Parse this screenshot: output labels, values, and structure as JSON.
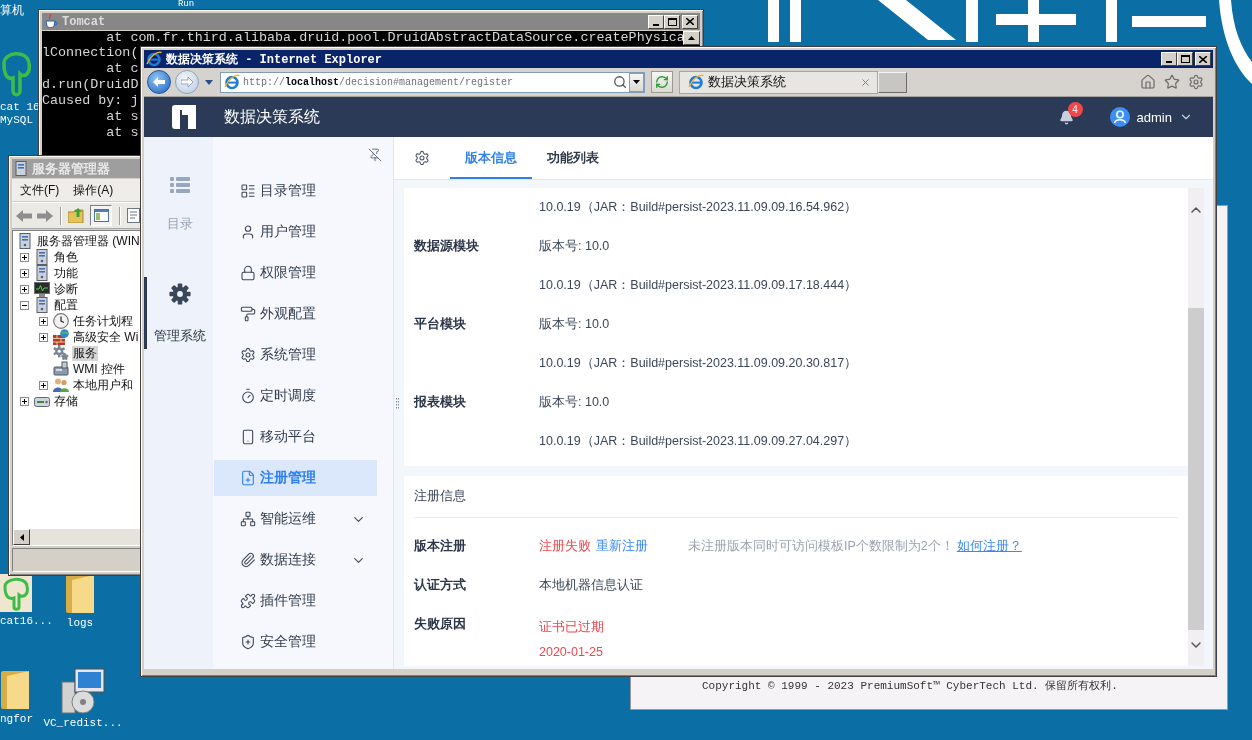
{
  "desktop": {
    "icons": [
      {
        "kind": "label",
        "label": [
          "算机"
        ]
      },
      {
        "kind": "label",
        "label": [
          "Run"
        ]
      },
      {
        "kind": "elephant",
        "label": [
          "cat 16",
          "MySQL"
        ]
      },
      {
        "kind": "elephant_tile",
        "label": [
          "cat16..."
        ]
      },
      {
        "kind": "folder",
        "label": [
          "logs"
        ]
      },
      {
        "kind": "folder",
        "label": [
          "ngfor"
        ]
      },
      {
        "kind": "installer",
        "label": [
          "VC_redist..."
        ]
      }
    ]
  },
  "tomcat_window": {
    "title": "Tomcat",
    "console_lines": [
      "        at com.fr.third.alibaba.druid.pool.DruidAbstractDataSource.createPhysica",
      "lConnection(",
      "        at c",
      "d.run(DruidD",
      "Caused by: j",
      "        at s",
      "        at s"
    ]
  },
  "server_manager_window": {
    "title": "服务器管理器",
    "menu": [
      "文件(F)",
      "操作(A)"
    ],
    "tree": [
      {
        "label": "服务器管理器 (WIN",
        "kind": "server",
        "selected": false,
        "children": [
          {
            "label": "角色",
            "kind": "roles",
            "expanded": false,
            "selected": false
          },
          {
            "label": "功能",
            "kind": "features",
            "expanded": false,
            "selected": false
          },
          {
            "label": "诊断",
            "kind": "diagnostics",
            "expanded": false,
            "selected": false
          },
          {
            "label": "配置",
            "kind": "configuration",
            "expanded": true,
            "selected": false,
            "children": [
              {
                "label": "任务计划程",
                "kind": "clock",
                "expanded": false,
                "selected": false
              },
              {
                "label": "高级安全 Wi",
                "kind": "firewall",
                "expanded": false,
                "selected": false
              },
              {
                "label": "服务",
                "kind": "services",
                "selected": true
              },
              {
                "label": "WMI 控件",
                "kind": "wmi",
                "selected": false
              },
              {
                "label": "本地用户和",
                "kind": "users",
                "expanded": false,
                "selected": false
              }
            ]
          },
          {
            "label": "存储",
            "kind": "storage",
            "expanded": false,
            "selected": false
          }
        ]
      }
    ]
  },
  "navicat_window": {
    "copyright": "Copyright © 1999 - 2023 PremiumSoft™ CyberTech Ltd. 保留所有权利."
  },
  "browser": {
    "title": "数据决策系统 - Internet Explorer",
    "back": {
      "disabled": false
    },
    "forward": {
      "disabled": true
    },
    "address": "http://**localhost**/decision#management/register",
    "tabs": [
      {
        "label": "数据决策系统",
        "selected": true
      }
    ]
  },
  "app": {
    "title": "数据决策系统",
    "notification_count": "4",
    "user": "admin",
    "rail": [
      {
        "kind": "list",
        "label": "目录",
        "selected": false
      },
      {
        "kind": "gear",
        "label": "管理系统",
        "selected": true
      }
    ],
    "nav": [
      {
        "kind": "catalog",
        "label": "目录管理",
        "selected": false
      },
      {
        "kind": "user",
        "label": "用户管理",
        "selected": false
      },
      {
        "kind": "lock",
        "label": "权限管理",
        "selected": false
      },
      {
        "kind": "appearance",
        "label": "外观配置",
        "selected": false
      },
      {
        "kind": "system",
        "label": "系统管理",
        "selected": false
      },
      {
        "kind": "schedule",
        "label": "定时调度",
        "selected": false
      },
      {
        "kind": "mobile",
        "label": "移动平台",
        "selected": false
      },
      {
        "kind": "register",
        "label": "注册管理",
        "selected": true
      },
      {
        "kind": "ops",
        "label": "智能运维",
        "selected": false,
        "expanded": false
      },
      {
        "kind": "connection",
        "label": "数据连接",
        "selected": false,
        "expanded": false
      },
      {
        "kind": "plugin",
        "label": "插件管理",
        "selected": false
      },
      {
        "kind": "security",
        "label": "安全管理",
        "selected": false
      }
    ],
    "tabs": [
      {
        "label": "版本信息",
        "selected": true
      },
      {
        "label": "功能列表",
        "selected": false
      }
    ],
    "version_rows": [
      {
        "value": "10.0.19（JAR：Build#persist-2023.11.09.09.16.54.962）"
      },
      {
        "label": "数据源模块",
        "value": "版本号: 10.0"
      },
      {
        "value": "10.0.19（JAR：Build#persist-2023.11.09.09.17.18.444）"
      },
      {
        "label": "平台模块",
        "value": "版本号: 10.0"
      },
      {
        "value": "10.0.19（JAR：Build#persist-2023.11.09.09.20.30.817）"
      },
      {
        "label": "报表模块",
        "value": "版本号: 10.0"
      },
      {
        "value": "10.0.19（JAR：Build#persist-2023.11.09.09.27.04.297）"
      }
    ],
    "registration": {
      "title": "注册信息",
      "rows": [
        {
          "kind": "status",
          "label": "版本注册",
          "status": "注册失败",
          "action": "重新注册",
          "note": "未注册版本同时可访问模板IP个数限制为2个！",
          "link": "如何注册？"
        },
        {
          "kind": "text",
          "label": "认证方式",
          "value": "本地机器信息认证"
        },
        {
          "kind": "error",
          "label": "失败原因",
          "lines": [
            "证书已过期",
            "2020-01-25"
          ]
        }
      ]
    }
  }
}
